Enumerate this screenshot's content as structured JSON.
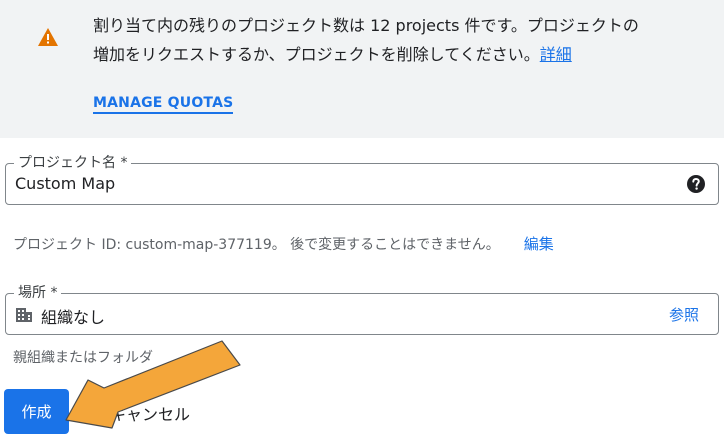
{
  "notice": {
    "text_line1": "割り当て内の残りのプロジェクト数は 12 projects 件です。プロジェクトの",
    "text_line2": "増加をリクエストするか、プロジェクトを削除してください。",
    "details_link": "詳細",
    "manage_quotas": "MANAGE QUOTAS",
    "icon": "warning-icon",
    "icon_color": "#e37400"
  },
  "project_name": {
    "label": "プロジェクト名 *",
    "value": "Custom Map",
    "help_icon": "help-icon"
  },
  "project_id_hint": {
    "text": "プロジェクト ID: custom-map-377119。 後で変更することはできません。",
    "edit_link": "編集"
  },
  "location": {
    "label": "場所 *",
    "value": "組織なし",
    "icon": "organization-icon",
    "browse": "参照"
  },
  "location_hint": {
    "text": "親組織またはフォルダ"
  },
  "actions": {
    "create": "作成",
    "cancel": "キャンセル"
  },
  "colors": {
    "accent": "#1a73e8",
    "annotation_arrow": "#f4a63a"
  }
}
